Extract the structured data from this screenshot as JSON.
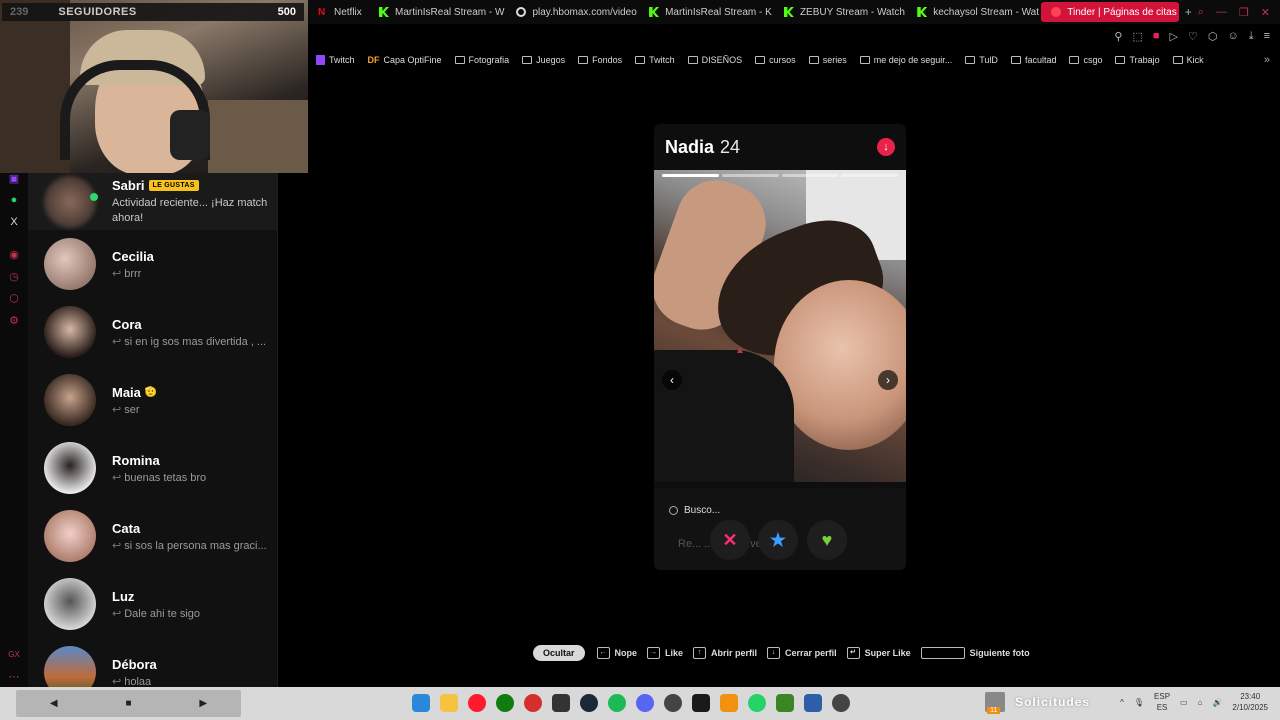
{
  "webcam": {
    "followers_label": "SEGUIDORES",
    "followers_left": "239",
    "followers_right": "500"
  },
  "tabs": [
    {
      "label": "Netflix",
      "icon": "netflix-icon"
    },
    {
      "label": "MartinIsReal Stream - W",
      "icon": "kick-icon"
    },
    {
      "label": "play.hbomax.com/video",
      "icon": "hbo-icon"
    },
    {
      "label": "MartinIsReal Stream - K",
      "icon": "kick-icon"
    },
    {
      "label": "ZEBUY Stream - Watch",
      "icon": "kick-icon"
    },
    {
      "label": "kechaysol Stream - Wat",
      "icon": "kick-icon"
    },
    {
      "label": "Tinder | Páginas de citas",
      "icon": "tinder-icon",
      "active": true
    }
  ],
  "bookmarks": [
    "Twitch",
    "Capa OptiFine",
    "Fotografia",
    "Juegos",
    "Fondos",
    "Twitch",
    "DISEÑOS",
    "cursos",
    "series",
    "me dejo de seguir...",
    "TulD",
    "facultad",
    "csgo",
    "Trabajo",
    "Kick"
  ],
  "matches": [
    {
      "name": "Sabri",
      "badge": "LE GUSTAS",
      "message": "Actividad reciente... ¡Haz match ahora!",
      "online": true
    },
    {
      "name": "Cecilia",
      "message": "brrr"
    },
    {
      "name": "Cora",
      "message": "si en ig sos mas divertida , ..."
    },
    {
      "name": "Maia",
      "emoji": "🫡",
      "message": "ser"
    },
    {
      "name": "Romina",
      "message": "buenas tetas bro"
    },
    {
      "name": "Cata",
      "message": "si sos la persona mas graci..."
    },
    {
      "name": "Luz",
      "message": "Dale ahi te sigo"
    },
    {
      "name": "Débora",
      "message": "holaa"
    }
  ],
  "profile": {
    "name": "Nadia",
    "age": "24",
    "photo_count": 4,
    "current_photo": 1,
    "search_label": "Busco...",
    "looking_for_text": "Re... ...per... ...ve..."
  },
  "actions": {
    "nope": "✕",
    "super_like": "★",
    "like": "♥"
  },
  "shortcuts": {
    "hide": "Ocultar",
    "nope": "Nope",
    "like": "Like",
    "open_profile": "Abrir perfil",
    "close_profile": "Cerrar perfil",
    "super_like": "Super Like",
    "next_photo": "Siguiente foto"
  },
  "taskbar": {
    "tray_text": "Solicitudes",
    "lang_top": "ESP",
    "lang_bottom": "ES",
    "time": "23:40",
    "date": "2/10/2025",
    "mail_count": "11"
  },
  "colors": {
    "tinder_red": "#d3143a",
    "kick_green": "#53fc18",
    "like_badge": "#f7c31b"
  }
}
